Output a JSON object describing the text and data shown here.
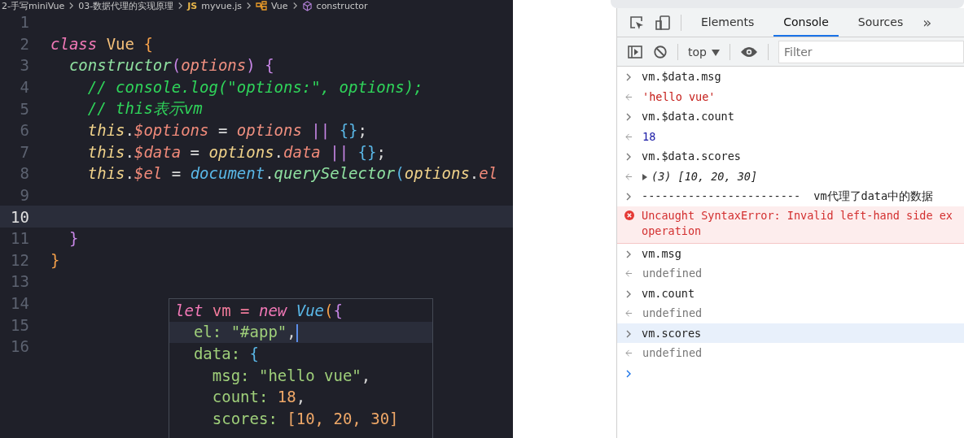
{
  "breadcrumb": [
    {
      "kind": "folder",
      "label": "2-手写miniVue"
    },
    {
      "kind": "folder",
      "label": "03-数据代理的实现原理"
    },
    {
      "kind": "file",
      "badge": "JS",
      "label": "myvue.js"
    },
    {
      "kind": "class",
      "label": "Vue"
    },
    {
      "kind": "method",
      "label": "constructor"
    }
  ],
  "editor": {
    "lines": [
      {
        "number": "1",
        "current": false
      },
      {
        "number": "2",
        "current": false,
        "tokens": [
          {
            "text": "class",
            "kind": "keyword"
          },
          {
            "text": " Vue",
            "kind": "type"
          },
          {
            "text": " {",
            "kind": "brace"
          }
        ]
      },
      {
        "number": "3",
        "current": false,
        "tokens": [
          {
            "text": "  constructor",
            "kind": "func"
          },
          {
            "text": "(",
            "kind": "paren"
          },
          {
            "text": "options",
            "kind": "param"
          },
          {
            "text": ")",
            "kind": "paren"
          },
          {
            "text": " {",
            "kind": "paren"
          }
        ]
      },
      {
        "number": "4",
        "current": false,
        "tokens": [
          {
            "text": "    // console.log(\"options:\", options);",
            "kind": "comment"
          }
        ]
      },
      {
        "number": "5",
        "current": false,
        "tokens": [
          {
            "text": "    // this表示vm",
            "kind": "comment"
          }
        ]
      },
      {
        "number": "6",
        "current": false,
        "tokens": [
          {
            "text": "    this",
            "kind": "this"
          },
          {
            "text": ".",
            "kind": "plain"
          },
          {
            "text": "$options",
            "kind": "prop"
          },
          {
            "text": " = ",
            "kind": "plain"
          },
          {
            "text": "options",
            "kind": "param"
          },
          {
            "text": " || ",
            "kind": "op"
          },
          {
            "text": "{}",
            "kind": "object"
          },
          {
            "text": ";",
            "kind": "plain"
          }
        ]
      },
      {
        "number": "7",
        "current": false,
        "tokens": [
          {
            "text": "    this",
            "kind": "this"
          },
          {
            "text": ".",
            "kind": "plain"
          },
          {
            "text": "$data",
            "kind": "prop"
          },
          {
            "text": " = ",
            "kind": "plain"
          },
          {
            "text": "options",
            "kind": "this"
          },
          {
            "text": ".",
            "kind": "plain"
          },
          {
            "text": "data",
            "kind": "prop"
          },
          {
            "text": " || ",
            "kind": "op"
          },
          {
            "text": "{}",
            "kind": "object"
          },
          {
            "text": ";",
            "kind": "plain"
          }
        ]
      },
      {
        "number": "8",
        "current": false,
        "tokens": [
          {
            "text": "    this",
            "kind": "this"
          },
          {
            "text": ".",
            "kind": "plain"
          },
          {
            "text": "$el",
            "kind": "prop"
          },
          {
            "text": " = ",
            "kind": "plain"
          },
          {
            "text": "document",
            "kind": "global"
          },
          {
            "text": ".",
            "kind": "plain"
          },
          {
            "text": "querySelector",
            "kind": "func"
          },
          {
            "text": "(",
            "kind": "object"
          },
          {
            "text": "options",
            "kind": "this"
          },
          {
            "text": ".",
            "kind": "plain"
          },
          {
            "text": "el",
            "kind": "prop"
          }
        ]
      },
      {
        "number": "9",
        "current": false
      },
      {
        "number": "10",
        "current": true
      },
      {
        "number": "11",
        "current": false,
        "tokens": [
          {
            "text": "  }",
            "kind": "paren"
          }
        ]
      },
      {
        "number": "12",
        "current": false,
        "tokens": [
          {
            "text": "}",
            "kind": "brace"
          }
        ]
      },
      {
        "number": "13",
        "current": false
      },
      {
        "number": "14",
        "current": false
      },
      {
        "number": "15",
        "current": false
      },
      {
        "number": "16",
        "current": false
      }
    ]
  },
  "hover_popup": {
    "lines": [
      {
        "current": false,
        "tokens": [
          {
            "text": "let",
            "kind": "keyword"
          },
          {
            "text": " vm = ",
            "kind": "kw2"
          },
          {
            "text": "new",
            "kind": "keyword"
          },
          {
            "text": " Vue",
            "kind": "global"
          },
          {
            "text": "(",
            "kind": "brace"
          },
          {
            "text": "{",
            "kind": "paren"
          }
        ]
      },
      {
        "current": true,
        "tokens": [
          {
            "text": "  el: ",
            "kind": "key"
          },
          {
            "text": "\"#app\"",
            "kind": "key"
          },
          {
            "text": ",",
            "kind": "plain"
          }
        ]
      },
      {
        "current": false,
        "tokens": [
          {
            "text": "  data: ",
            "kind": "key"
          },
          {
            "text": "{",
            "kind": "object"
          }
        ]
      },
      {
        "current": false,
        "tokens": [
          {
            "text": "    msg: ",
            "kind": "key"
          },
          {
            "text": "\"hello vue\"",
            "kind": "key"
          },
          {
            "text": ",",
            "kind": "plain"
          }
        ]
      },
      {
        "current": false,
        "tokens": [
          {
            "text": "    count: ",
            "kind": "key"
          },
          {
            "text": "18",
            "kind": "number"
          },
          {
            "text": ",",
            "kind": "plain"
          }
        ]
      },
      {
        "current": false,
        "tokens": [
          {
            "text": "    scores: ",
            "kind": "key"
          },
          {
            "text": "[10, 20, 30]",
            "kind": "number"
          }
        ]
      }
    ]
  },
  "devtools": {
    "tabs": [
      {
        "label": "Elements",
        "selected": false
      },
      {
        "label": "Console",
        "selected": true
      },
      {
        "label": "Sources",
        "selected": false
      }
    ],
    "more_tabs": "»",
    "context": "top",
    "filter": {
      "placeholder": "Filter"
    },
    "entries": [
      {
        "kind": "input",
        "text": "vm.$data.msg",
        "highlighted": false
      },
      {
        "kind": "string",
        "text": "'hello vue'",
        "highlighted": false
      },
      {
        "kind": "input",
        "text": "vm.$data.count",
        "highlighted": false
      },
      {
        "kind": "number",
        "text": "18",
        "highlighted": false
      },
      {
        "kind": "input",
        "text": "vm.$data.scores",
        "highlighted": false
      },
      {
        "kind": "array",
        "text": "(3) [10, 20, 30]",
        "highlighted": false
      },
      {
        "kind": "input",
        "text": "------------------------  vm代理了data中的数据",
        "highlighted": false
      },
      {
        "kind": "error",
        "text": "Uncaught SyntaxError: Invalid left-hand side ex",
        "text2": "operation",
        "highlighted": false
      },
      {
        "kind": "input",
        "text": "vm.msg",
        "highlighted": false
      },
      {
        "kind": "undefined",
        "text": "undefined",
        "highlighted": false
      },
      {
        "kind": "input",
        "text": "vm.count",
        "highlighted": false
      },
      {
        "kind": "undefined",
        "text": "undefined",
        "highlighted": false
      },
      {
        "kind": "input",
        "text": "vm.scores",
        "highlighted": true
      },
      {
        "kind": "undefined",
        "text": "undefined",
        "highlighted": false
      },
      {
        "kind": "prompt",
        "highlighted": false
      }
    ]
  }
}
